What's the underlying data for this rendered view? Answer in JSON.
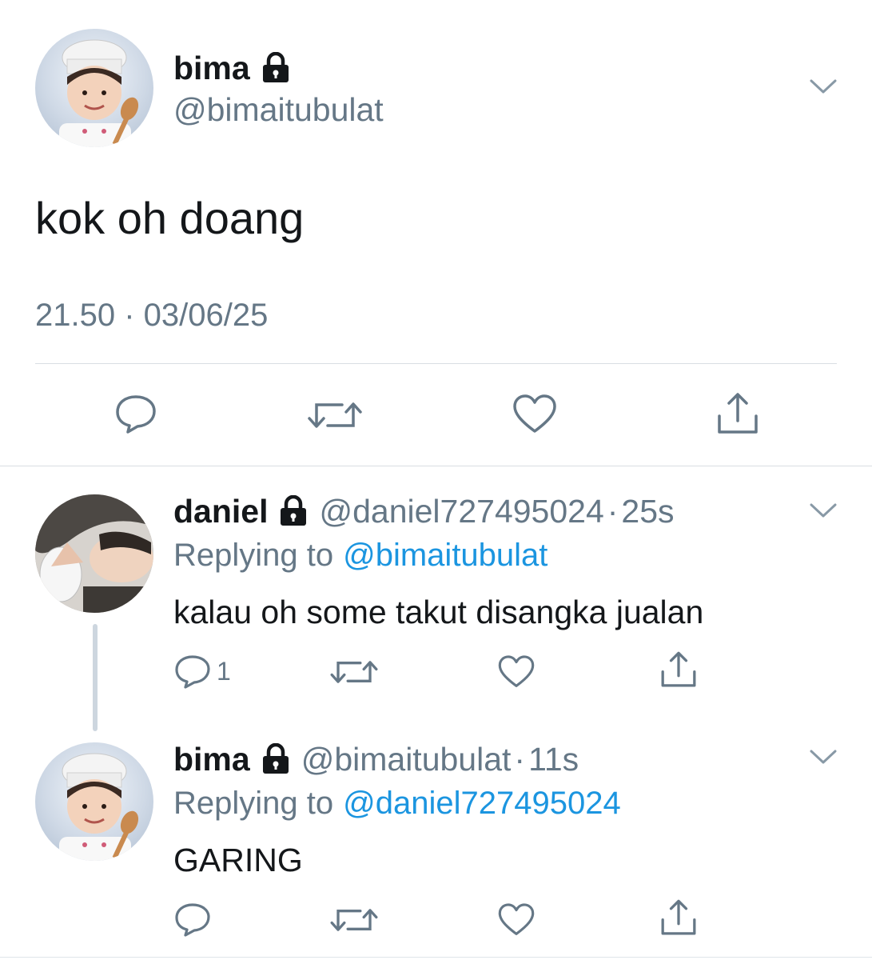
{
  "main_tweet": {
    "author_name": "bima",
    "author_handle": "@bimaitubulat",
    "text": "kok oh doang",
    "timestamp": "21.50 · 03/06/25",
    "protected_icon": "lock-icon",
    "menu_icon": "chevron-down-icon",
    "actions": [
      "reply-icon",
      "retweet-icon",
      "like-icon",
      "share-icon"
    ]
  },
  "replies": [
    {
      "author_name": "daniel",
      "author_handle": "@daniel727495024",
      "separator": "·",
      "time_ago": "25s",
      "replying_label": "Replying to",
      "replying_to": "@bimaitubulat",
      "text": "kalau oh some takut disangka jualan",
      "reply_count": "1"
    },
    {
      "author_name": "bima",
      "author_handle": "@bimaitubulat",
      "separator": "·",
      "time_ago": "11s",
      "replying_label": "Replying to",
      "replying_to": "@daniel727495024",
      "text": "GARING"
    }
  ],
  "colors": {
    "text": "#14171a",
    "secondary": "#657786",
    "link": "#1b95e0",
    "divider": "#d9dee3"
  }
}
